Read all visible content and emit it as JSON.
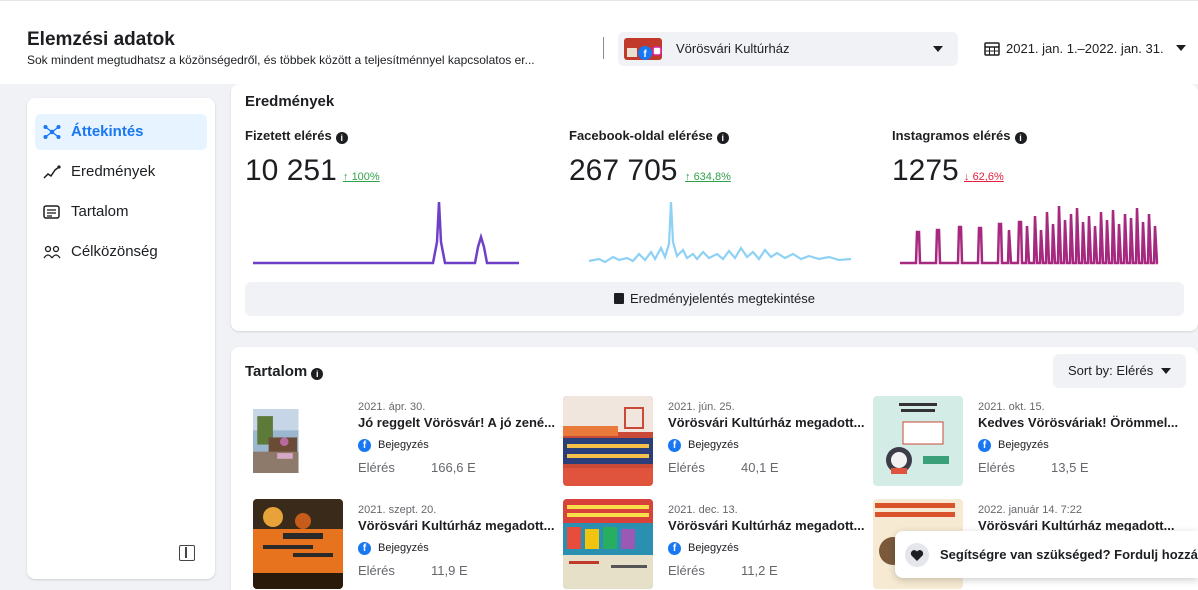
{
  "header": {
    "title": "Elemzési adatok",
    "subtitle": "Sok mindent megtudhatsz a közönségedről, és többek között a teljesítménnyel kapcsolatos er...",
    "page_selector": "Vörösvári Kultúrház",
    "date_range": "2021. jan. 1.–2022. jan. 31."
  },
  "sidebar": {
    "items": [
      {
        "label": "Áttekintés",
        "icon": "overview-icon",
        "active": true
      },
      {
        "label": "Eredmények",
        "icon": "results-icon",
        "active": false
      },
      {
        "label": "Tartalom",
        "icon": "content-icon",
        "active": false
      },
      {
        "label": "Célközönség",
        "icon": "audience-icon",
        "active": false
      }
    ]
  },
  "results": {
    "title": "Eredmények",
    "metrics": [
      {
        "label": "Fizetett elérés",
        "value": "10 251",
        "arrow": "↑",
        "change": "100%",
        "direction": "up",
        "color": "#6e3fc7"
      },
      {
        "label": "Facebook-oldal elérése",
        "value": "267 705",
        "arrow": "↑",
        "change": "634,8%",
        "direction": "up",
        "color": "#8ed1f5"
      },
      {
        "label": "Instagramos elérés",
        "value": "1275",
        "arrow": "↓",
        "change": "62,6%",
        "direction": "down",
        "color": "#a6287f"
      }
    ],
    "report_button": "Eredményjelentés megtekintése"
  },
  "content": {
    "title": "Tartalom",
    "sort_label": "Sort by: Elérés",
    "reach_label": "Elérés",
    "posts": [
      {
        "date": "2021. ápr. 30.",
        "title": "Jó reggelt Vörösvár! A jó zené...",
        "type": "Bejegyzés",
        "reach": "166,6 E"
      },
      {
        "date": "2021. jún. 25.",
        "title": "Vörösvári Kultúrház megadott...",
        "type": "Bejegyzés",
        "reach": "40,1 E"
      },
      {
        "date": "2021. okt. 15.",
        "title": "Kedves Vörösváriak! Örömmel...",
        "type": "Bejegyzés",
        "reach": "13,5 E"
      },
      {
        "date": "2021. szept. 20.",
        "title": "Vörösvári Kultúrház megadott...",
        "type": "Bejegyzés",
        "reach": "11,9 E"
      },
      {
        "date": "2021. dec. 13.",
        "title": "Vörösvári Kultúrház megadott...",
        "type": "Bejegyzés",
        "reach": "11,2 E"
      },
      {
        "date": "2022. január 14. 7:22",
        "title": "Vörösvári Kultúrház megadott...",
        "type": "",
        "reach": ""
      }
    ]
  },
  "help": {
    "text": "Segítségre van szükséged? Fordulj hozzánk"
  },
  "colors": {
    "accent": "#1877f2",
    "up": "#31a24c",
    "down": "#e41e3f"
  }
}
